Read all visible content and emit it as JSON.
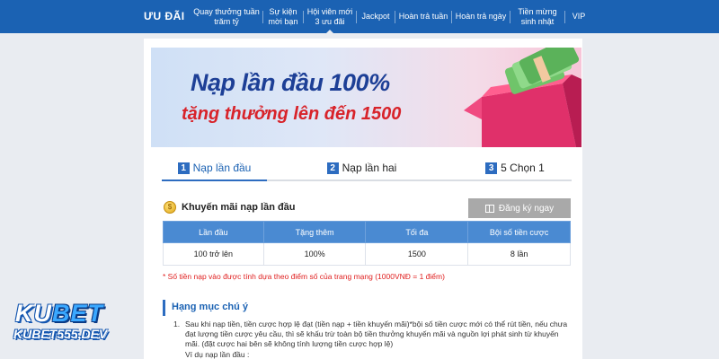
{
  "nav": {
    "brand": "ƯU ĐÃI",
    "items": [
      {
        "label": "Quay thưởng tuần\ntrăm tỷ"
      },
      {
        "label": "Sự kiện\nmời bạn"
      },
      {
        "label": "Hội viên mới\n3 ưu đãi"
      },
      {
        "label": "Jackpot"
      },
      {
        "label": "Hoàn trả tuần"
      },
      {
        "label": "Hoàn trả ngày"
      },
      {
        "label": "Tiền mừng\nsinh nhật"
      },
      {
        "label": "VIP"
      }
    ],
    "active_index": 2
  },
  "banner": {
    "line1": "Nạp lần đầu 100%",
    "line2": "tặng thưởng lên đến 1500"
  },
  "tabs": [
    {
      "num": "1",
      "label": "Nạp lần đầu"
    },
    {
      "num": "2",
      "label": "Nạp lần hai"
    },
    {
      "num": "3",
      "label": "5 Chọn 1"
    }
  ],
  "promo": {
    "title": "Khuyến mãi nạp lần đầu",
    "register_label": "Đăng ký ngay"
  },
  "table": {
    "headers": [
      "Lần đầu",
      "Tặng thêm",
      "Tối đa",
      "Bội số tiền cược"
    ],
    "rows": [
      [
        "100 trở lên",
        "100%",
        "1500",
        "8 lần"
      ]
    ]
  },
  "note": "* Số tiền nạp vào được tính dựa theo điểm số của trang mạng (1000VNĐ = 1 điểm)",
  "section_title": "Hạng mục chú ý",
  "rules": {
    "index": "1.",
    "text": "Sau khi nạp tiền, tiền cược hợp lệ đạt (tiền nạp + tiền khuyến mãi)*bội số tiền cược mới có thể rút tiền, nếu chưa đạt lượng tiền cược yêu cầu, thì sẽ khấu trừ toàn bộ tiền thưởng khuyến mãi và nguồn lợi phát sinh từ khuyến mãi. (đặt cược hai bên sẽ không tính lượng tiền cược hợp lệ)",
    "example": "Ví dụ nạp lần đầu :"
  },
  "watermark": {
    "brand_a": "KU",
    "brand_b": "BET",
    "site": "KUBET555.DEV"
  },
  "colors": {
    "nav_bg": "#1b62b3",
    "accent": "#2d6cc0",
    "table_header": "#4a8ad2",
    "note_red": "#e02020"
  }
}
